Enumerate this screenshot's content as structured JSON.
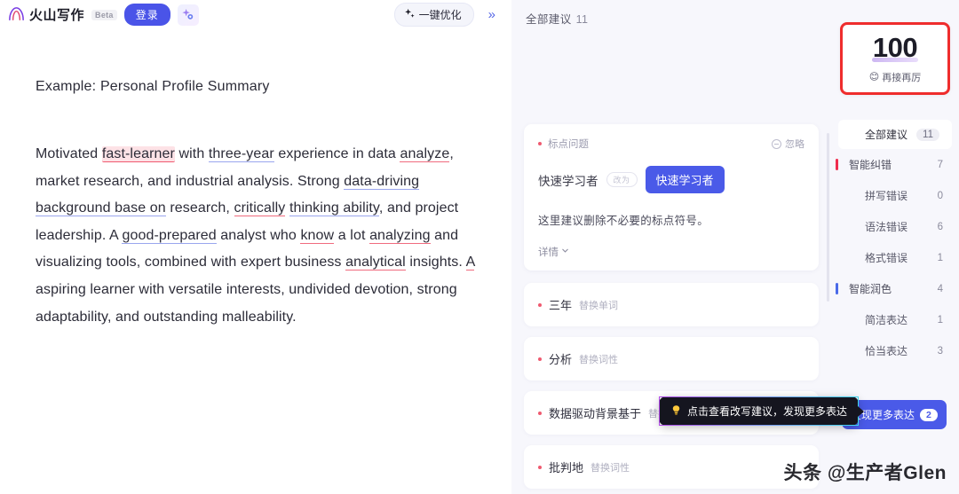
{
  "topbar": {
    "brand_name": "火山写作",
    "beta_label": "Beta",
    "login_label": "登录",
    "ai_icon": "sparkle-ai-icon",
    "optimize_label": "一键优化",
    "optimize_icon": "sparkle-icon",
    "collapse_label": "»"
  },
  "document": {
    "title": "Example: Personal Profile Summary",
    "segments": [
      {
        "text": "Motivated ",
        "mark": "none"
      },
      {
        "text": "fast-learner",
        "mark": "highlight-red"
      },
      {
        "text": " with ",
        "mark": "none"
      },
      {
        "text": "three-year",
        "mark": "underline-blue"
      },
      {
        "text": " experience in data ",
        "mark": "none"
      },
      {
        "text": "analyze",
        "mark": "underline-red"
      },
      {
        "text": ", market research, and industrial analysis. Strong ",
        "mark": "none"
      },
      {
        "text": "data-driving background base on",
        "mark": "underline-blue"
      },
      {
        "text": " research, ",
        "mark": "none"
      },
      {
        "text": "critically",
        "mark": "underline-red"
      },
      {
        "text": " ",
        "mark": "none"
      },
      {
        "text": "thinking ability",
        "mark": "underline-blue"
      },
      {
        "text": ", and project leadership. A ",
        "mark": "none"
      },
      {
        "text": "good-prepared",
        "mark": "underline-blue"
      },
      {
        "text": " analyst who ",
        "mark": "none"
      },
      {
        "text": "know",
        "mark": "underline-red"
      },
      {
        "text": " a lot ",
        "mark": "none"
      },
      {
        "text": "analyzing",
        "mark": "underline-red"
      },
      {
        "text": " and visualizing tools, combined with expert business ",
        "mark": "none"
      },
      {
        "text": "analytical",
        "mark": "underline-red"
      },
      {
        "text": " insights. ",
        "mark": "none"
      },
      {
        "text": "A",
        "mark": "underline-red"
      },
      {
        "text": " aspiring learner with versatile interests, undivided devotion, strong adaptability, and outstanding malleability.",
        "mark": "none"
      }
    ]
  },
  "suggestions": {
    "header_label": "全部建议",
    "header_count": "11",
    "card": {
      "tag": "标点问题",
      "ignore_label": "忽略",
      "ignore_icon": "circle-minus-icon",
      "old_text": "快速学习者",
      "arrow_label": "改为",
      "new_text": "快速学习者",
      "description": "这里建议删除不必要的标点符号。",
      "more_label": "详情",
      "more_icon": "chevron-down-icon"
    },
    "items": [
      {
        "word": "三年",
        "type": "替换单词"
      },
      {
        "word": "分析",
        "type": "替换词性"
      },
      {
        "word": "数据驱动背景基于",
        "type": "替换词性"
      },
      {
        "word": "批判地",
        "type": "替换词性"
      }
    ]
  },
  "score_panel": {
    "score": "100",
    "score_sub": "再接再厉",
    "score_emoji": "😊",
    "categories": [
      {
        "label": "全部建议",
        "count": "11",
        "level": "all",
        "bar": "none"
      },
      {
        "label": "智能纠错",
        "count": "7",
        "level": "main",
        "bar": "#ef2d4e"
      },
      {
        "label": "拼写错误",
        "count": "0",
        "level": "sub",
        "bar": "none"
      },
      {
        "label": "语法错误",
        "count": "6",
        "level": "sub",
        "bar": "none"
      },
      {
        "label": "格式错误",
        "count": "1",
        "level": "sub",
        "bar": "none"
      },
      {
        "label": "智能润色",
        "count": "4",
        "level": "main",
        "bar": "#4a6ae8"
      },
      {
        "label": "简洁表达",
        "count": "1",
        "level": "sub",
        "bar": "none"
      },
      {
        "label": "恰当表达",
        "count": "3",
        "level": "sub",
        "bar": "none"
      }
    ],
    "more_button_label": "发现更多表达",
    "more_button_badge": "2"
  },
  "tooltip": {
    "icon": "lightbulb-icon",
    "text": "点击查看改写建议，发现更多表达"
  },
  "watermark": {
    "text": "头条 @生产者Glen"
  },
  "colors": {
    "accent": "#4a5ae8",
    "error": "#ef2d4e",
    "polish": "#4a6ae8",
    "score_border": "#ef2d2d"
  }
}
